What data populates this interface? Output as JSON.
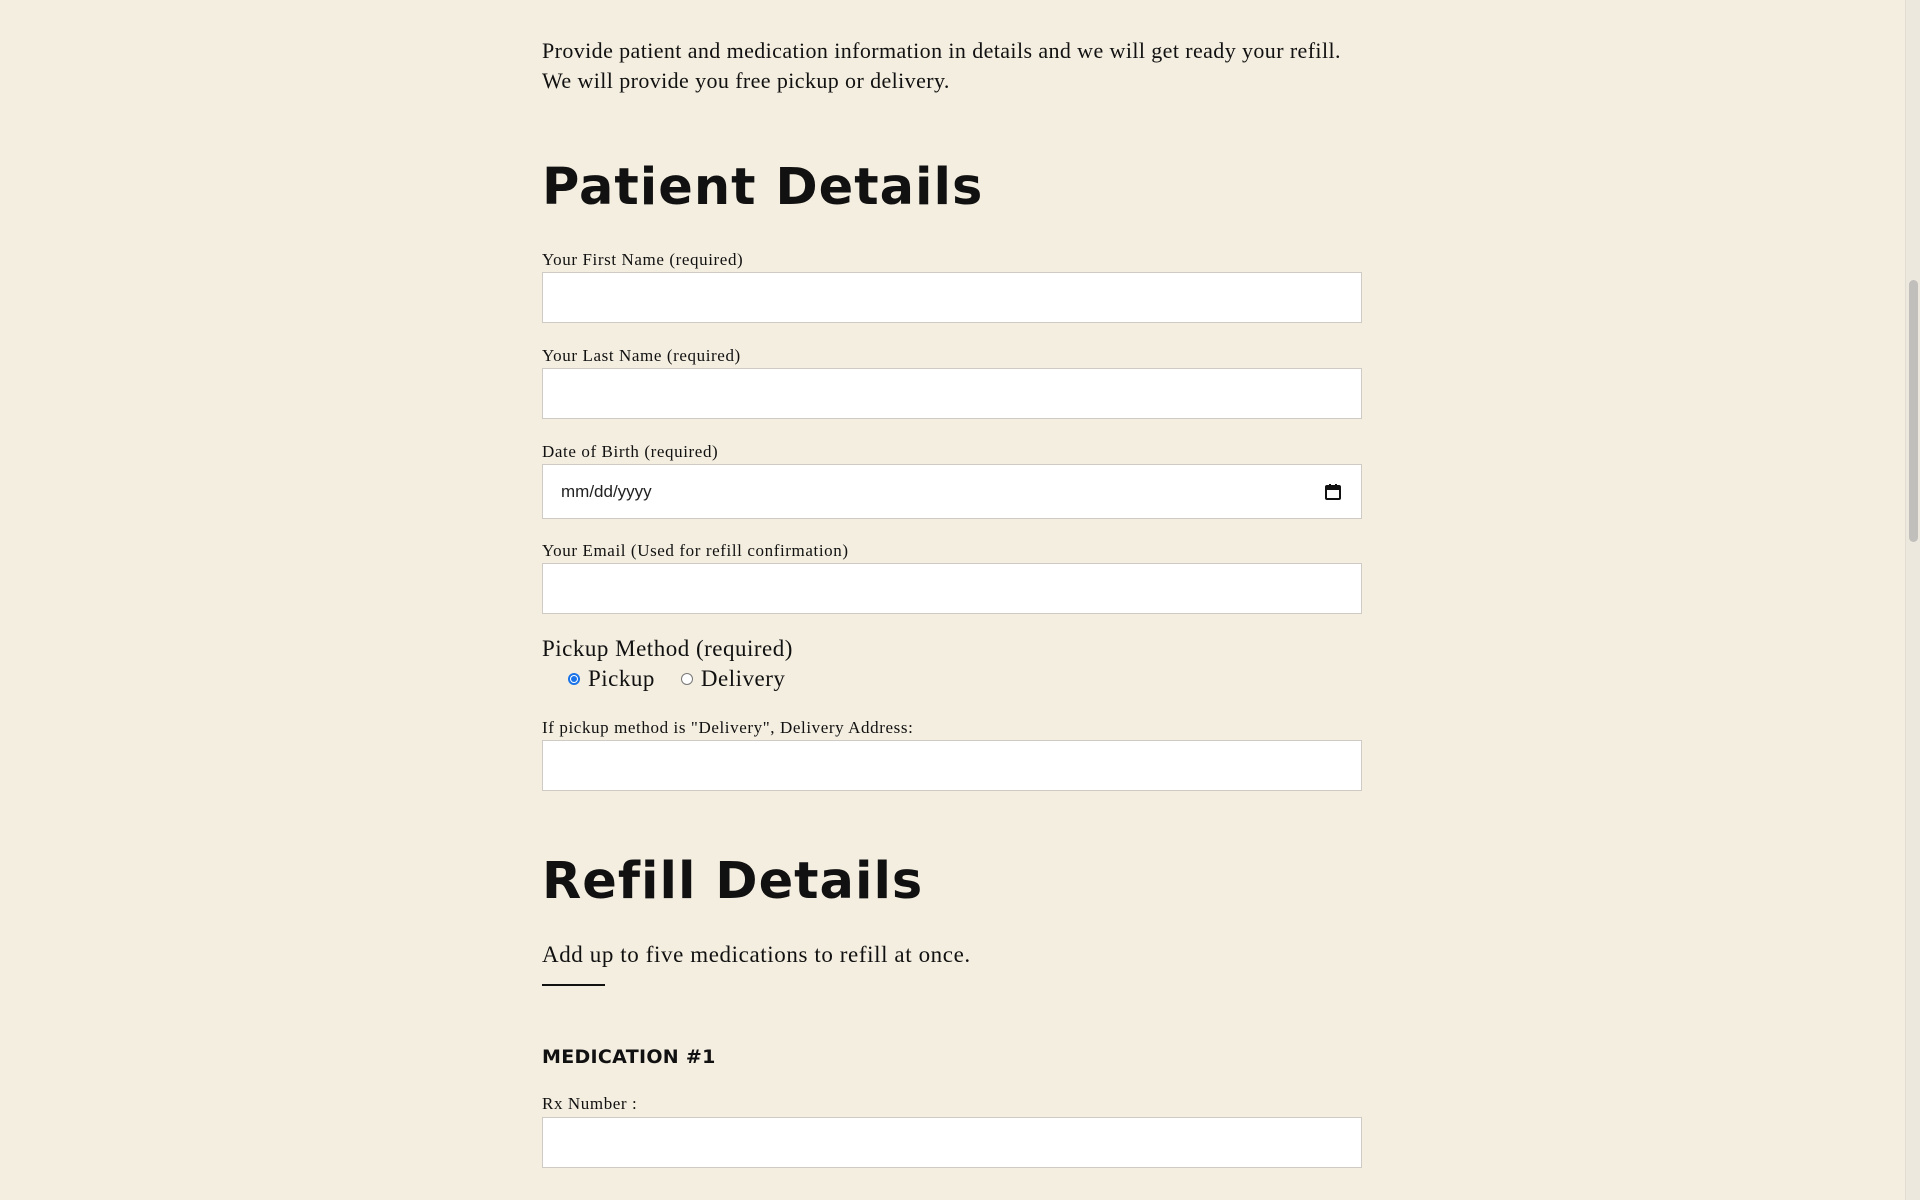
{
  "intro": "Provide patient and medication information in details and we will get ready your refill. We will provide you free pickup or delivery.",
  "patient": {
    "heading": "Patient Details",
    "first_name_label": "Your First Name (required)",
    "first_name_value": "",
    "last_name_label": "Your Last Name (required)",
    "last_name_value": "",
    "dob_label": "Date of Birth (required)",
    "dob_placeholder": "mm/dd/yyyy",
    "email_label": "Your Email (Used for refill confirmation)",
    "email_value": "",
    "pickup_method_label": "Pickup Method (required)",
    "pickup_options": [
      {
        "label": "Pickup",
        "checked": true
      },
      {
        "label": "Delivery",
        "checked": false
      }
    ],
    "delivery_address_label": "If pickup method is \"Delivery\", Delivery Address:",
    "delivery_address_value": ""
  },
  "refill": {
    "heading": "Refill Details",
    "subtitle": "Add up to five medications to refill at once.",
    "medication_heading": "MEDICATION #1",
    "rx_label": "Rx Number :",
    "rx_value": ""
  },
  "colors": {
    "background": "#f4eee0",
    "radio_accent": "#1a73e8"
  },
  "icons": {
    "date_picker": "calendar-icon"
  }
}
